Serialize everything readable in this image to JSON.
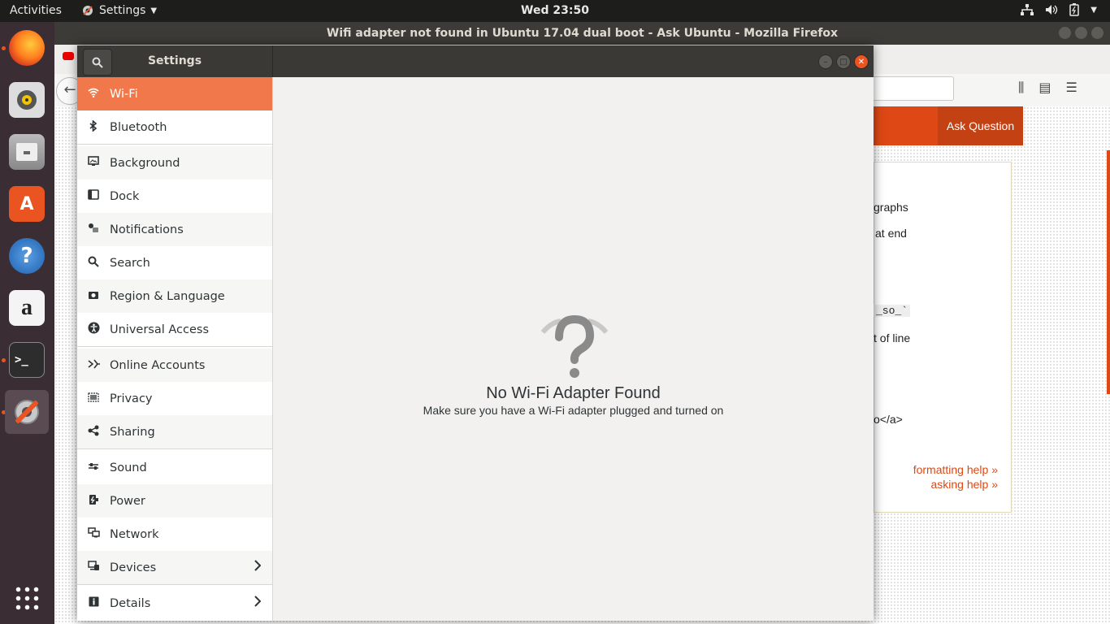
{
  "topbar": {
    "activities": "Activities",
    "app_menu": "Settings",
    "clock": "Wed 23:50"
  },
  "firefox": {
    "window_title": "Wifi adapter not found in Ubuntu 17.04 dual boot - Ask Ubuntu - Mozilla Firefox",
    "ask_question": "Ask Question",
    "fragments": [
      "graphs",
      "at end",
      "_so_`",
      "t of line",
      "o</a>"
    ],
    "formatting_help": "formatting help »",
    "asking_help": "asking help »"
  },
  "dock": {
    "items": [
      "firefox-icon",
      "rhythmbox-icon",
      "files-icon",
      "software-icon",
      "help-icon",
      "amazon-icon",
      "terminal-icon",
      "settings-icon"
    ]
  },
  "settings": {
    "title": "Settings",
    "sidebar": [
      {
        "label": "Wi-Fi",
        "icon": "wifi-icon"
      },
      {
        "label": "Bluetooth",
        "icon": "bluetooth-icon"
      },
      {
        "label": "Background",
        "icon": "background-icon"
      },
      {
        "label": "Dock",
        "icon": "dock-icon"
      },
      {
        "label": "Notifications",
        "icon": "notifications-icon"
      },
      {
        "label": "Search",
        "icon": "search-icon"
      },
      {
        "label": "Region & Language",
        "icon": "region-icon"
      },
      {
        "label": "Universal Access",
        "icon": "accessibility-icon"
      },
      {
        "label": "Online Accounts",
        "icon": "online-accounts-icon"
      },
      {
        "label": "Privacy",
        "icon": "privacy-icon"
      },
      {
        "label": "Sharing",
        "icon": "sharing-icon"
      },
      {
        "label": "Sound",
        "icon": "sound-icon"
      },
      {
        "label": "Power",
        "icon": "power-icon"
      },
      {
        "label": "Network",
        "icon": "network-icon"
      },
      {
        "label": "Devices",
        "icon": "devices-icon"
      },
      {
        "label": "Details",
        "icon": "details-icon"
      }
    ],
    "selected": "Wi-Fi",
    "empty_state": {
      "title": "No Wi-Fi Adapter Found",
      "subtitle": "Make sure you have a Wi-Fi adapter plugged and turned on"
    }
  }
}
